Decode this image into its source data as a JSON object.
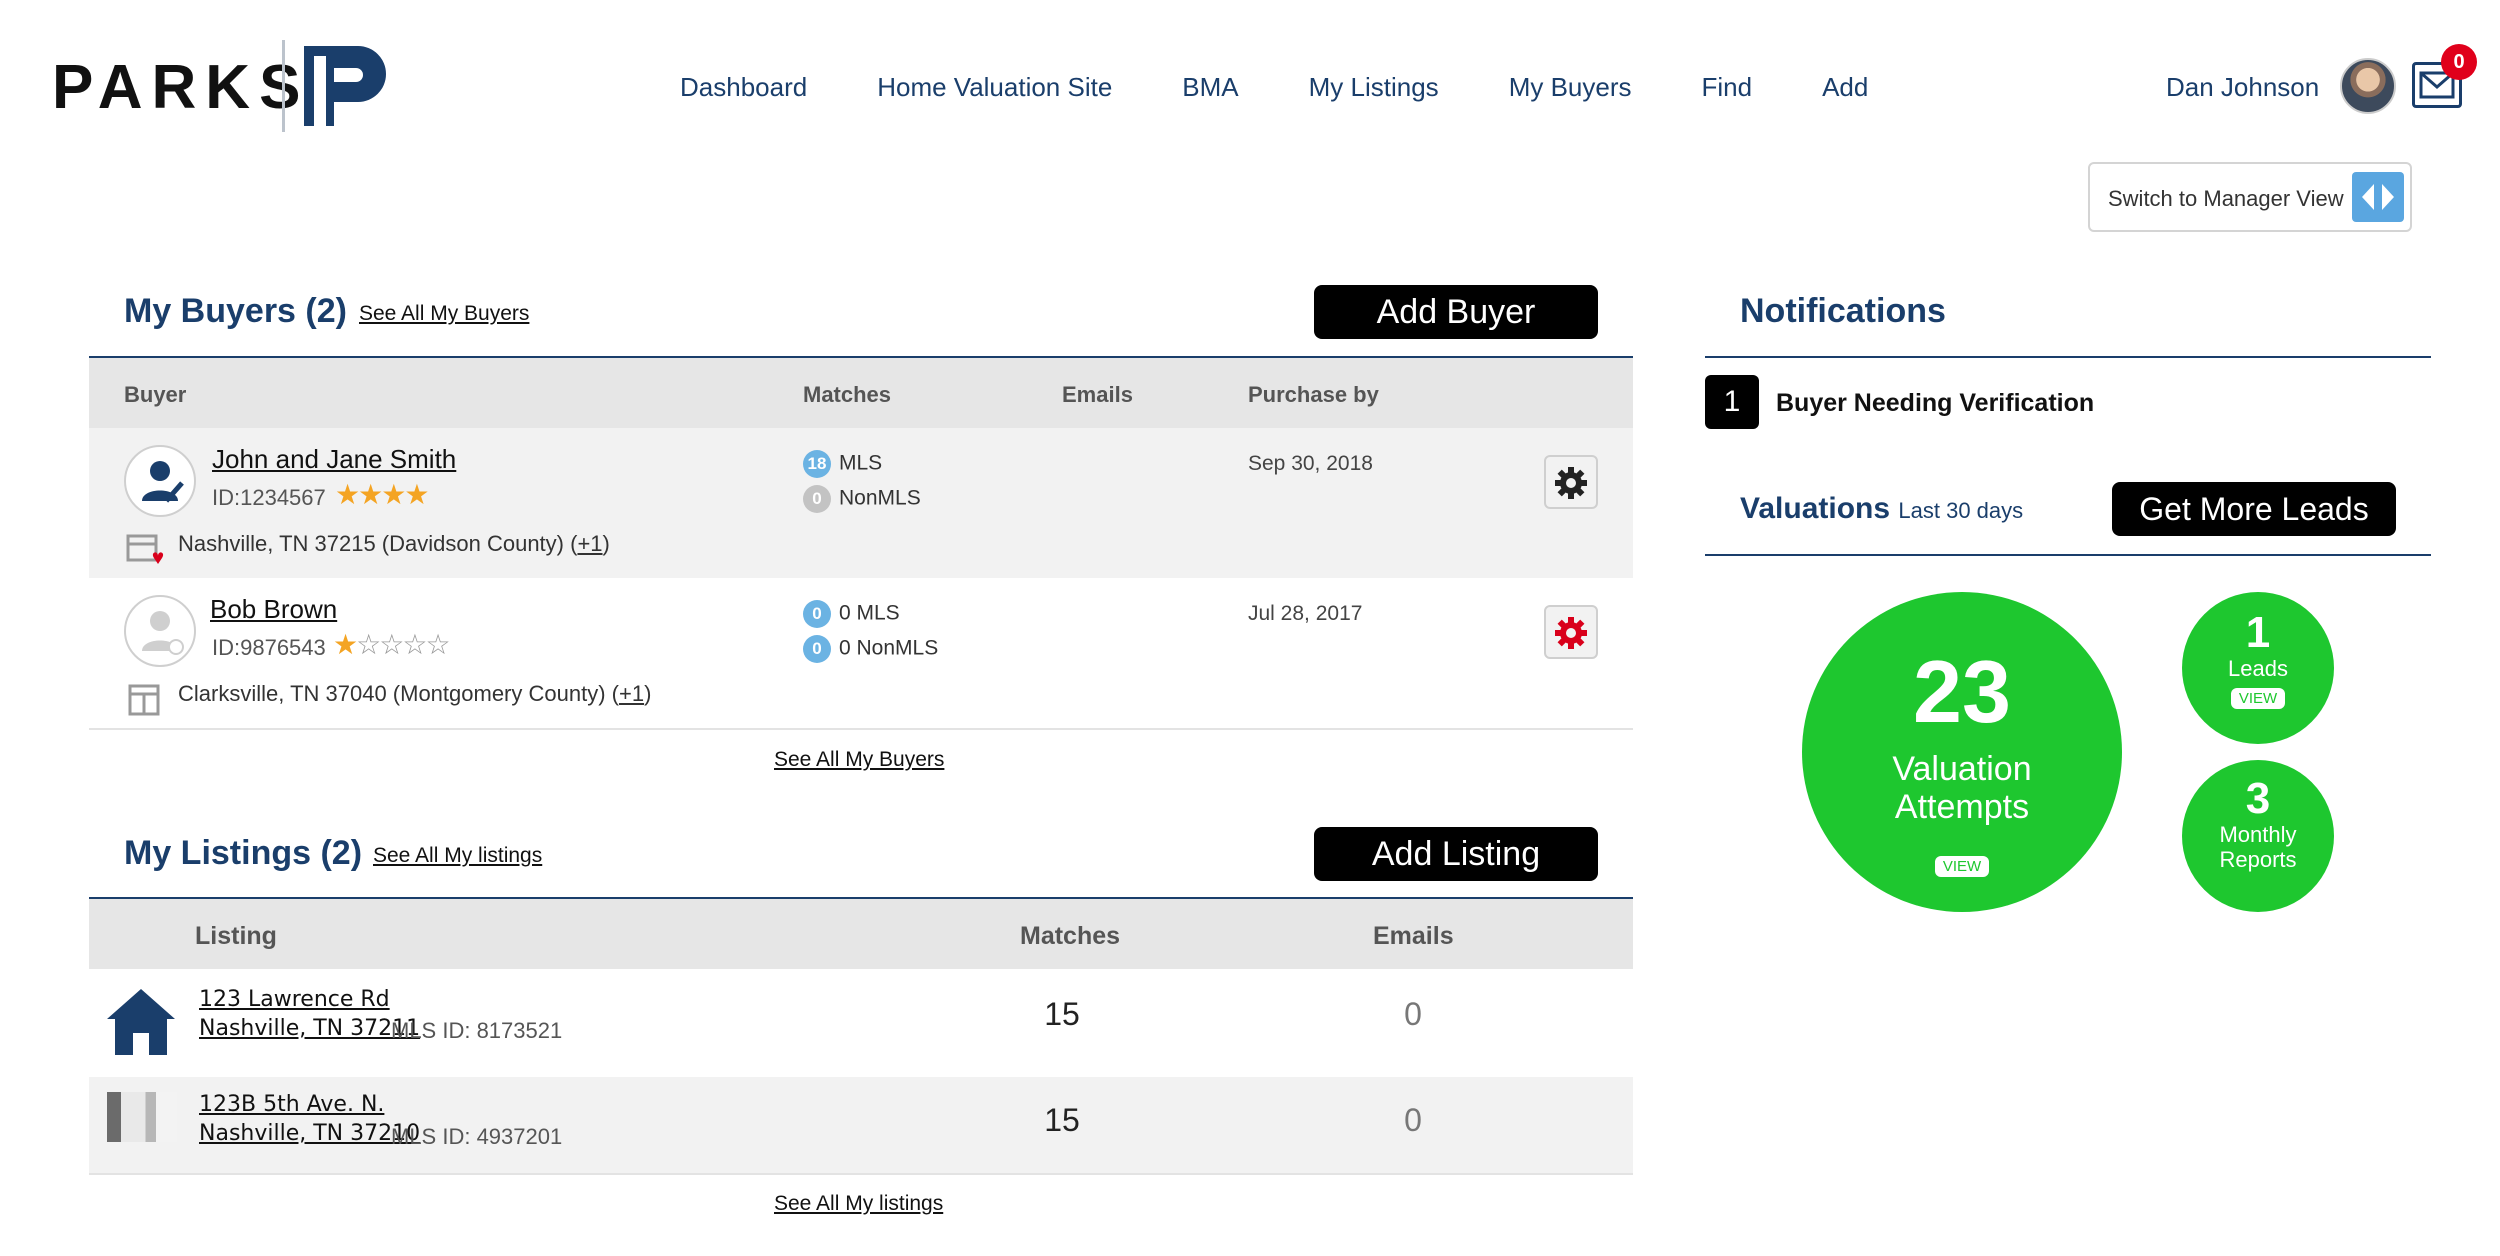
{
  "header": {
    "logo_text": "PARKS",
    "nav": [
      "Dashboard",
      "Home Valuation Site",
      "BMA",
      "My Listings",
      "My Buyers",
      "Find",
      "Add"
    ],
    "user_name": "Dan Johnson",
    "mail_count": "0",
    "switch_label": "Switch to Manager View"
  },
  "buyers": {
    "title": "My Buyers (2)",
    "see_all": "See All My Buyers",
    "add_label": "Add Buyer",
    "columns": [
      "Buyer",
      "Matches",
      "Emails",
      "Purchase by"
    ],
    "rows": [
      {
        "name": "John and Jane Smith",
        "id": "ID:1234567",
        "rating": 4,
        "mls_count": "18",
        "mls_label": "MLS",
        "nonmls_count": "0",
        "nonmls_label": "NonMLS",
        "purchase_by": "Sep 30, 2018",
        "location": "Nashville, TN 37215 (Davidson County) (",
        "plus": "+1",
        "location_end": ")"
      },
      {
        "name": "Bob Brown",
        "id": "ID:9876543",
        "rating": 1,
        "mls_count": "0",
        "mls_label": "0 MLS",
        "nonmls_count": "0",
        "nonmls_label": "0 NonMLS",
        "purchase_by": "Jul 28, 2017",
        "location": "Clarksville, TN 37040 (Montgomery County) (",
        "plus": "+1",
        "location_end": ")"
      }
    ],
    "footer_link": "See All My Buyers"
  },
  "listings": {
    "title": "My Listings (2)",
    "see_all": "See All My listings",
    "add_label": "Add Listing",
    "columns": [
      "Listing",
      "Matches",
      "Emails"
    ],
    "rows": [
      {
        "line1": "123 Lawrence Rd",
        "line2": "Nashville, TN 37211",
        "mls": "MLS ID:  8173521",
        "matches": "15",
        "emails": "0"
      },
      {
        "line1": "123B 5th Ave. N.",
        "line2": "Nashville, TN 37210",
        "mls": "MLS ID:  4937201",
        "matches": "15",
        "emails": "0"
      }
    ],
    "footer_link": "See All My listings"
  },
  "notifications": {
    "title": "Notifications",
    "count": "1",
    "item": "Buyer Needing Verification",
    "valuations_title": "Valuations",
    "valuations_period": "Last 30 days",
    "leads_button": "Get More Leads",
    "big": {
      "value": "23",
      "label_1": "Valuation",
      "label_2": "Attempts",
      "view": "VIEW"
    },
    "leads": {
      "value": "1",
      "label": "Leads",
      "view": "VIEW"
    },
    "reports": {
      "value": "3",
      "label_1": "Monthly",
      "label_2": "Reports"
    }
  },
  "colors": {
    "navy": "#1a3e6b",
    "green": "#1ec72f",
    "star": "#f4a423",
    "badge": "#e0001b"
  }
}
